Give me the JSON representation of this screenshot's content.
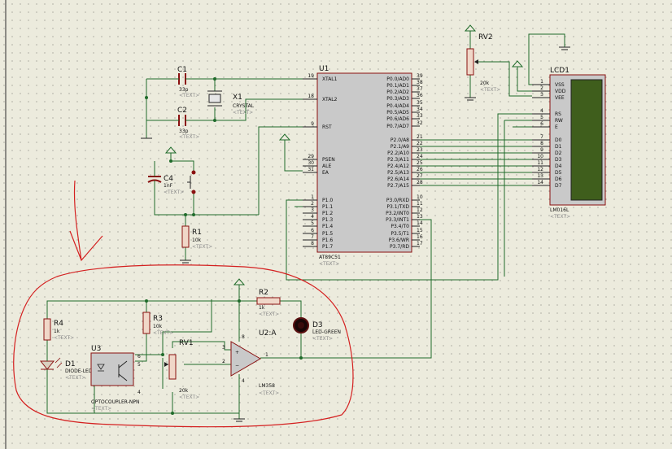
{
  "colors": {
    "background": "#ecebdd",
    "wire": "#1f6b2a",
    "component_fill": "#c9c9c9",
    "component_stroke": "#8a1010",
    "lcd_screen": "#3f5e1c",
    "annotation": "#d42020"
  },
  "u1": {
    "ref": "U1",
    "part": "AT89C51",
    "text": "<TEXT>",
    "left_pins": [
      {
        "name": "XTAL1",
        "num": "19"
      },
      {
        "name": "XTAL2",
        "num": "18"
      },
      {
        "name": "RST",
        "num": "9"
      },
      {
        "name": "PSEN",
        "num": "29"
      },
      {
        "name": "ALE",
        "num": "30"
      },
      {
        "name": "EA",
        "num": "31"
      },
      {
        "name": "P1.0",
        "num": "1"
      },
      {
        "name": "P1.1",
        "num": "2"
      },
      {
        "name": "P1.2",
        "num": "3"
      },
      {
        "name": "P1.3",
        "num": "4"
      },
      {
        "name": "P1.4",
        "num": "5"
      },
      {
        "name": "P1.5",
        "num": "6"
      },
      {
        "name": "P1.6",
        "num": "7"
      },
      {
        "name": "P1.7",
        "num": "8"
      }
    ],
    "right_pins": [
      {
        "name": "P0.0/AD0",
        "num": "39"
      },
      {
        "name": "P0.1/AD1",
        "num": "38"
      },
      {
        "name": "P0.2/AD2",
        "num": "37"
      },
      {
        "name": "P0.3/AD3",
        "num": "36"
      },
      {
        "name": "P0.4/AD4",
        "num": "35"
      },
      {
        "name": "P0.5/AD5",
        "num": "34"
      },
      {
        "name": "P0.6/AD6",
        "num": "33"
      },
      {
        "name": "P0.7/AD7",
        "num": "32"
      },
      {
        "name": "P2.0/A8",
        "num": "21"
      },
      {
        "name": "P2.1/A9",
        "num": "22"
      },
      {
        "name": "P2.2/A10",
        "num": "23"
      },
      {
        "name": "P2.3/A11",
        "num": "24"
      },
      {
        "name": "P2.4/A12",
        "num": "25"
      },
      {
        "name": "P2.5/A13",
        "num": "26"
      },
      {
        "name": "P2.6/A14",
        "num": "27"
      },
      {
        "name": "P2.7/A15",
        "num": "28"
      },
      {
        "name": "P3.0/RXD",
        "num": "10"
      },
      {
        "name": "P3.1/TXD",
        "num": "11"
      },
      {
        "name": "P3.2/INT0",
        "num": "12"
      },
      {
        "name": "P3.3/INT1",
        "num": "13"
      },
      {
        "name": "P3.4/T0",
        "num": "14"
      },
      {
        "name": "P3.5/T1",
        "num": "15"
      },
      {
        "name": "P3.6/WR",
        "num": "16"
      },
      {
        "name": "P3.7/RD",
        "num": "17"
      }
    ]
  },
  "lcd": {
    "ref": "LCD1",
    "part": "LM016L",
    "text": "<TEXT>",
    "pins": [
      {
        "name": "VSS",
        "num": "1"
      },
      {
        "name": "VDD",
        "num": "2"
      },
      {
        "name": "VEE",
        "num": "3"
      },
      {
        "name": "RS",
        "num": "4"
      },
      {
        "name": "RW",
        "num": "5"
      },
      {
        "name": "E",
        "num": "6"
      },
      {
        "name": "D0",
        "num": "7"
      },
      {
        "name": "D1",
        "num": "8"
      },
      {
        "name": "D2",
        "num": "9"
      },
      {
        "name": "D3",
        "num": "10"
      },
      {
        "name": "D4",
        "num": "11"
      },
      {
        "name": "D5",
        "num": "12"
      },
      {
        "name": "D6",
        "num": "13"
      },
      {
        "name": "D7",
        "num": "14"
      }
    ]
  },
  "c1": {
    "ref": "C1",
    "value": "33p",
    "text": "<TEXT>"
  },
  "c2": {
    "ref": "C2",
    "value": "33p",
    "text": "<TEXT>"
  },
  "x1": {
    "ref": "X1",
    "value": "CRYSTAL",
    "text": "<TEXT>"
  },
  "c4": {
    "ref": "C4",
    "value": "1nF",
    "text": "<TEXT>"
  },
  "r1": {
    "ref": "R1",
    "value": "10k",
    "text": "<TEXT>"
  },
  "rv2": {
    "ref": "RV2",
    "value": "20k",
    "text": "<TEXT>"
  },
  "r2": {
    "ref": "R2",
    "value": "1k",
    "text": "<TEXT>"
  },
  "r3": {
    "ref": "R3",
    "value": "10k",
    "text": "<TEXT>"
  },
  "r4": {
    "ref": "R4",
    "value": "1k",
    "text": "<TEXT>"
  },
  "d1": {
    "ref": "D1",
    "value": "DIODE-LED",
    "text": "<TEXT>"
  },
  "d3": {
    "ref": "D3",
    "value": "LED-GREEN",
    "text": "<TEXT>"
  },
  "u3": {
    "ref": "U3",
    "value": "OPTOCOUPLER-NPN",
    "text": "<TEXT>",
    "pins": [
      "6",
      "5",
      "4"
    ]
  },
  "rv1": {
    "ref": "RV1",
    "value": "20k",
    "text": "<TEXT>"
  },
  "u2": {
    "ref": "U2:A",
    "value": "LM358",
    "text": "<TEXT>",
    "pins": [
      "3",
      "2",
      "1",
      "8",
      "4"
    ]
  }
}
